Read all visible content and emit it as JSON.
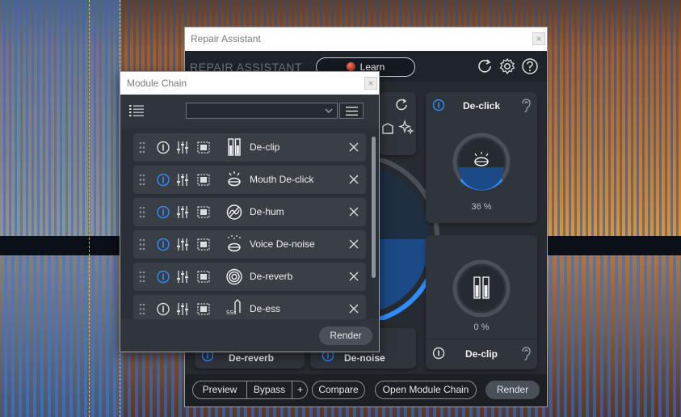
{
  "repair_assistant": {
    "window_title": "Repair Assistant",
    "heading": "REPAIR ASSISTANT",
    "learn_label": "Learn",
    "panels": {
      "declick": {
        "title": "De-click",
        "percent": "36 %",
        "level": 0.36
      },
      "declip": {
        "title": "De-clip",
        "percent": "0 %",
        "level": 0
      },
      "dereverb_partial": "De-reverb",
      "denoise_partial": "De-noise"
    },
    "footer": {
      "preview": "Preview",
      "bypass": "Bypass",
      "plus": "+",
      "compare": "Compare",
      "open_chain": "Open Module Chain",
      "render": "Render"
    }
  },
  "module_chain": {
    "window_title": "Module Chain",
    "close": "×",
    "preset_value": "",
    "modules": [
      {
        "name": "De-clip",
        "icon": "declip-icon",
        "active": false
      },
      {
        "name": "Mouth De-click",
        "icon": "mouth-declick-icon",
        "active": true
      },
      {
        "name": "De-hum",
        "icon": "dehum-icon",
        "active": true
      },
      {
        "name": "Voice De-noise",
        "icon": "voice-denoise-icon",
        "active": true
      },
      {
        "name": "De-reverb",
        "icon": "dereverb-icon",
        "active": true
      },
      {
        "name": "De-ess",
        "icon": "deess-icon",
        "active": false
      }
    ],
    "render_label": "Render"
  },
  "colors": {
    "accent_blue": "#2f8cff",
    "panel": "#30353c",
    "window": "#2b3037"
  }
}
